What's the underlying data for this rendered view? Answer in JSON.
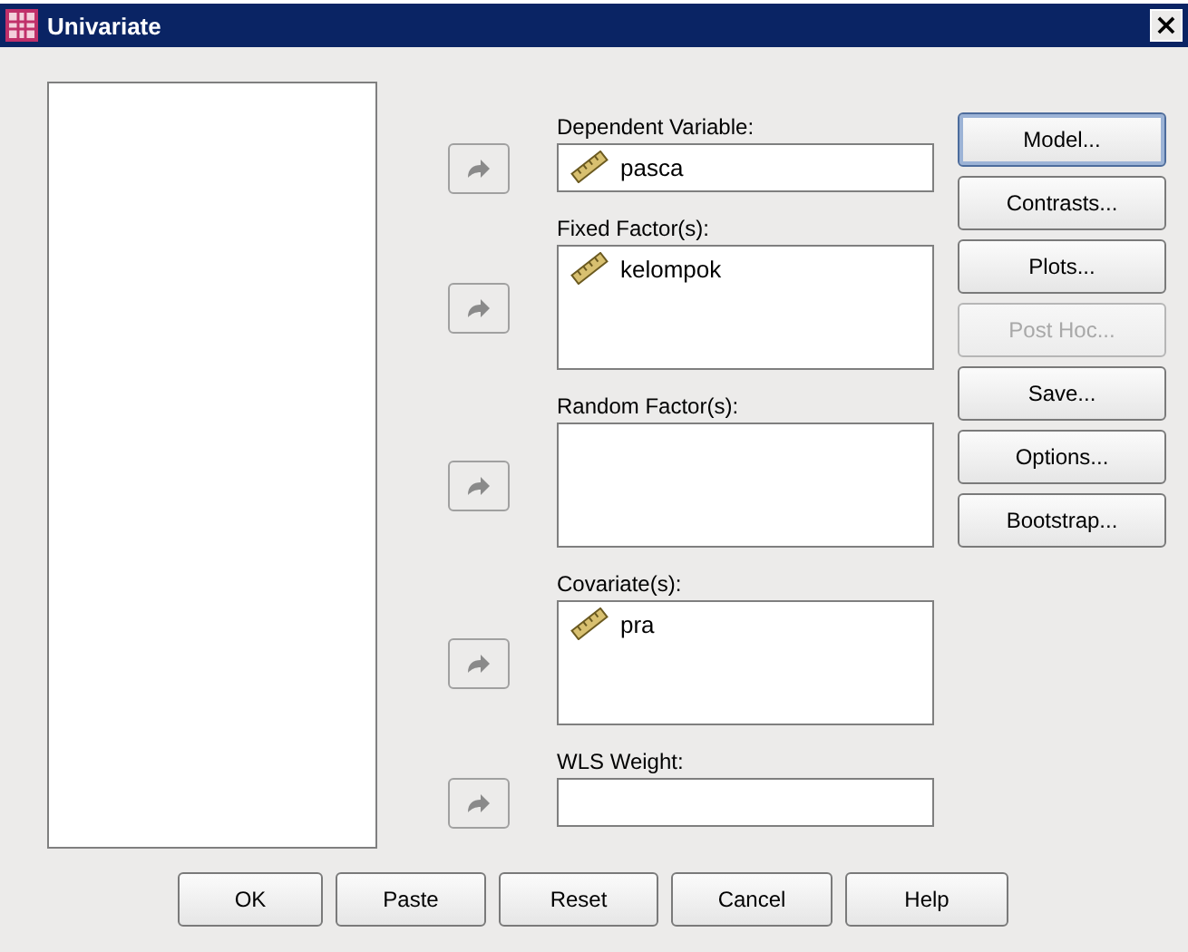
{
  "window": {
    "title": "Univariate",
    "close": "×"
  },
  "targets": [
    {
      "label": "Dependent Variable:",
      "kind": "field",
      "items": [
        "pasca"
      ]
    },
    {
      "label": "Fixed Factor(s):",
      "kind": "list",
      "items": [
        "kelompok"
      ]
    },
    {
      "label": "Random Factor(s):",
      "kind": "list"
    },
    {
      "label": "Covariate(s):",
      "kind": "list",
      "items": [
        "pra"
      ]
    },
    {
      "label": "WLS Weight:",
      "kind": "field"
    }
  ],
  "side_buttons": [
    {
      "label": "Model...",
      "disabled": false,
      "focused": true
    },
    {
      "label": "Contrasts...",
      "disabled": false,
      "focused": false
    },
    {
      "label": "Plots...",
      "disabled": false,
      "focused": false
    },
    {
      "label": "Post Hoc...",
      "disabled": true,
      "focused": false
    },
    {
      "label": "Save...",
      "disabled": false,
      "focused": false
    },
    {
      "label": "Options...",
      "disabled": false,
      "focused": false
    },
    {
      "label": "Bootstrap...",
      "disabled": false,
      "focused": false
    }
  ],
  "bottom_buttons": [
    "OK",
    "Paste",
    "Reset",
    "Cancel",
    "Help"
  ]
}
